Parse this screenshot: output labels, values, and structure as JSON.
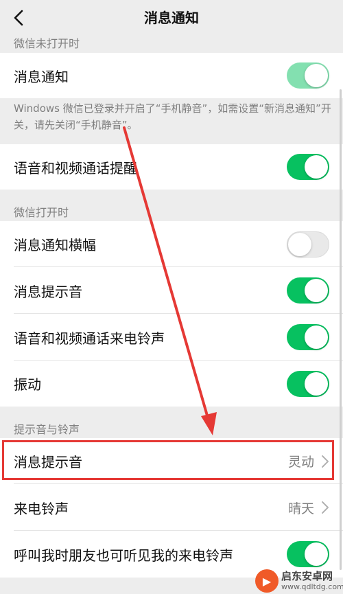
{
  "header": {
    "title": "消息通知"
  },
  "sections": {
    "wechat_closed": "微信未打开时",
    "wechat_open": "微信打开时",
    "sounds": "提示音与铃声"
  },
  "rows": {
    "notify": {
      "label": "消息通知",
      "on": true
    },
    "note": "Windows 微信已登录并开启了“手机静音”，如需设置“新消息通知”开关，请先关闭“手机静音”。",
    "call_alert": {
      "label": "语音和视频通话提醒",
      "on": true
    },
    "banner": {
      "label": "消息通知横幅",
      "on": false
    },
    "msg_sound": {
      "label": "消息提示音",
      "on": true
    },
    "call_ringtone": {
      "label": "语音和视频通话来电铃声",
      "on": true
    },
    "vibrate": {
      "label": "振动",
      "on": true
    },
    "msg_tone": {
      "label": "消息提示音",
      "value": "灵动"
    },
    "ringtone": {
      "label": "来电铃声",
      "value": "晴天"
    },
    "friends_hear": {
      "label": "呼叫我时朋友也可听见我的来电铃声",
      "on": true
    }
  },
  "watermark": {
    "name": "启东安卓网",
    "url": "www.qdltdg.com"
  },
  "colors": {
    "switch_on": "#07c160",
    "highlight": "#e53935"
  }
}
